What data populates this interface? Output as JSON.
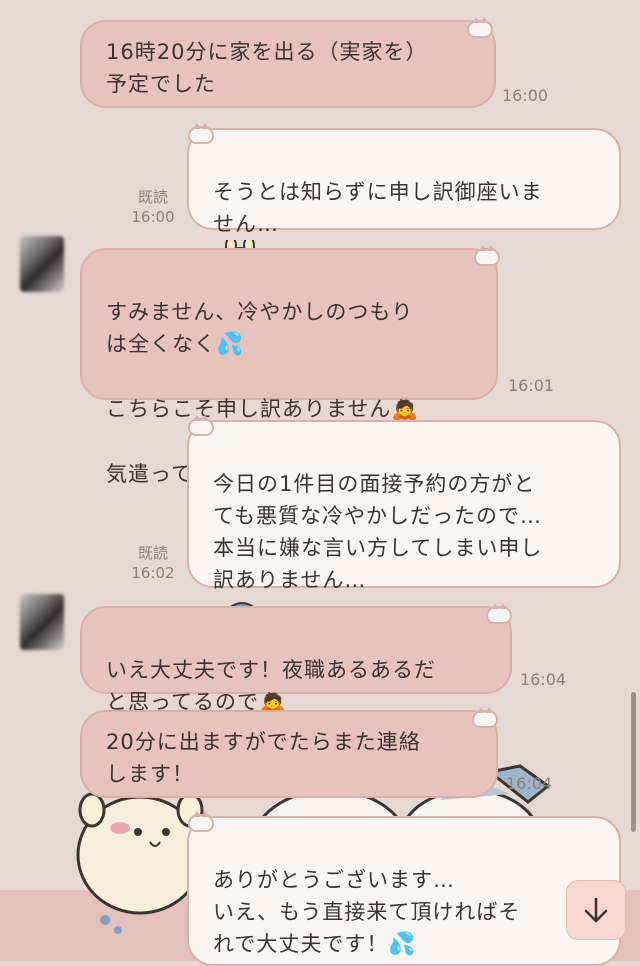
{
  "messages": [
    {
      "text": "16時20分に家を出る（実家を）\n予定でした",
      "time": "16:00"
    },
    {
      "text": "そうとは知らずに申し訳御座いま\nせん…",
      "read": "既読",
      "time": "16:00",
      "sticker": "crying-bunny-icon"
    },
    {
      "text": "すみません、冷やかしのつもり\nは全くなく",
      "line3": "こちらこそ申し訳ありません",
      "line4": "気遣って頂いて助かります！",
      "time": "16:01",
      "emoji_sweat": "💦",
      "emoji_bow": "🙇"
    },
    {
      "text": "今日の1件目の面接予約の方がと\nても悪質な冷やかしだったので…\n本当に嫌な言い方してしまい申し\n訳ありません…",
      "read": "既読",
      "time": "16:02",
      "sticker": "crying-cat-icon"
    },
    {
      "text": "いえ大丈夫です！夜職あるあるだ\nと思ってるので",
      "time": "16:04",
      "emoji_bow": "🙇"
    },
    {
      "text": "20分に出ますがでたらまた連絡\nします！",
      "time": "16:04"
    },
    {
      "text": "ありがとうございます…\nいえ、もう直接来て頂ければそ\nれで大丈夫です！",
      "emoji_sweat": "💦"
    }
  ],
  "scroll_down_icon": "arrow-down-icon",
  "colors": {
    "background": "#e6d9d4",
    "incoming": "#e6c4bd",
    "outgoing": "#fcf6f3",
    "accent": "#d9b1a8"
  }
}
